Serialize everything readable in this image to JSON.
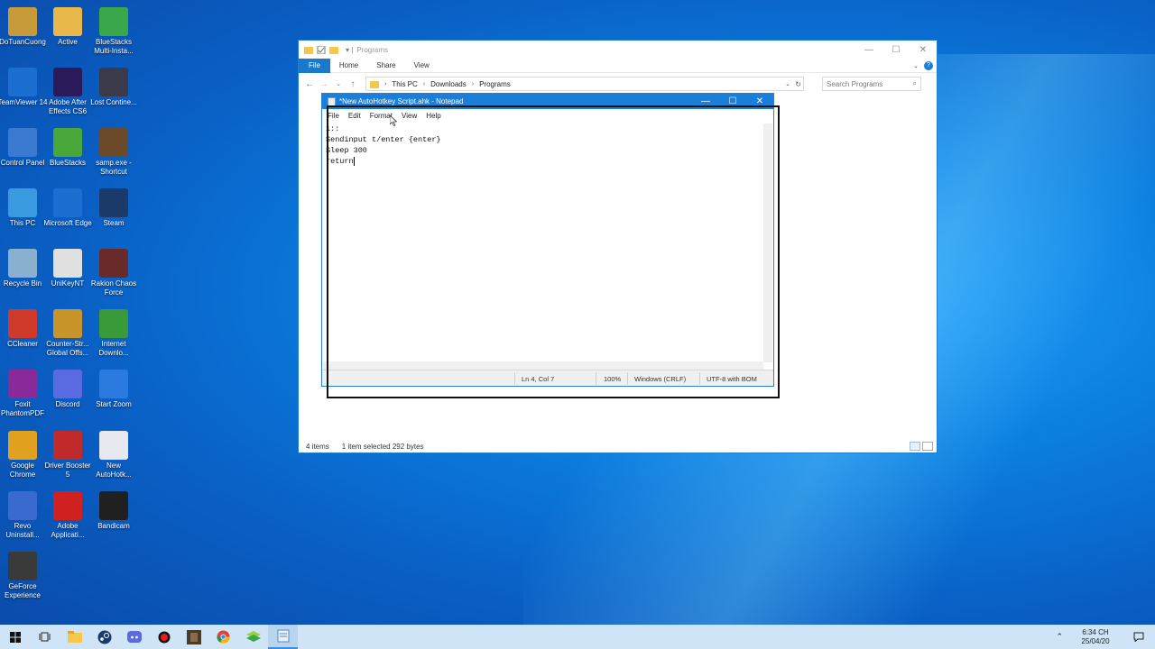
{
  "desktop_icons": [
    {
      "label": "DoTuanCuong",
      "color": "#c99a3a"
    },
    {
      "label": "Active",
      "color": "#e8b84a"
    },
    {
      "label": "BlueStacks Multi-Insta...",
      "color": "#3aa84a"
    },
    {
      "label": "TeamViewer 14",
      "color": "#1a6fd0"
    },
    {
      "label": "Adobe After Effects CS6",
      "color": "#2a1a5a"
    },
    {
      "label": "Lost Contine...",
      "color": "#3a3a4a"
    },
    {
      "label": "Control Panel",
      "color": "#3a7ad0"
    },
    {
      "label": "BlueStacks",
      "color": "#4aa83a"
    },
    {
      "label": "samp.exe - Shortcut",
      "color": "#6a4a2a"
    },
    {
      "label": "This PC",
      "color": "#3a9ae0"
    },
    {
      "label": "Microsoft Edge",
      "color": "#1a6fd0"
    },
    {
      "label": "Steam",
      "color": "#1a3a6a"
    },
    {
      "label": "Recycle Bin",
      "color": "#8ab0d0"
    },
    {
      "label": "UniKeyNT",
      "color": "#e0e0e0"
    },
    {
      "label": "Rakion Chaos Force",
      "color": "#6a2a2a"
    },
    {
      "label": "CCleaner",
      "color": "#d03a2a"
    },
    {
      "label": "Counter-Str... Global Offs...",
      "color": "#c8952a"
    },
    {
      "label": "Internet Downlo...",
      "color": "#3a9a3a"
    },
    {
      "label": "Foxit PhantomPDF",
      "color": "#8a2a9a"
    },
    {
      "label": "Discord",
      "color": "#5a6ae0"
    },
    {
      "label": "Start Zoom",
      "color": "#2a7ae0"
    },
    {
      "label": "Google Chrome",
      "color": "#e0a020"
    },
    {
      "label": "Driver Booster 5",
      "color": "#c02a2a"
    },
    {
      "label": "New AutoHotk...",
      "color": "#e8e8f0"
    },
    {
      "label": "Revo Uninstall...",
      "color": "#3a6ad0"
    },
    {
      "label": "Adobe Applicati...",
      "color": "#d02020"
    },
    {
      "label": "Bandicam",
      "color": "#202020"
    },
    {
      "label": "GeForce Experience",
      "color": "#3a3a3a"
    }
  ],
  "explorer": {
    "title": "Programs",
    "ribbon": {
      "file": "File",
      "home": "Home",
      "share": "Share",
      "view": "View"
    },
    "breadcrumb": [
      "This PC",
      "Downloads",
      "Programs"
    ],
    "search_placeholder": "Search Programs",
    "status_items": "4 items",
    "status_selected": "1 item selected  292 bytes"
  },
  "notepad": {
    "title": "*New AutoHotkey Script.ahk - Notepad",
    "menu": {
      "file": "File",
      "edit": "Edit",
      "format": "Format",
      "view": "View",
      "help": "Help"
    },
    "lines": [
      "1::",
      "Sendinput t/enter {enter}",
      "Sleep 300",
      "return"
    ],
    "status": {
      "position": "Ln 4, Col 7",
      "zoom": "100%",
      "line_ending": "Windows (CRLF)",
      "encoding": "UTF-8 with BOM"
    }
  },
  "taskbar": {
    "time": "6:34 CH",
    "date": "25/04/20"
  }
}
